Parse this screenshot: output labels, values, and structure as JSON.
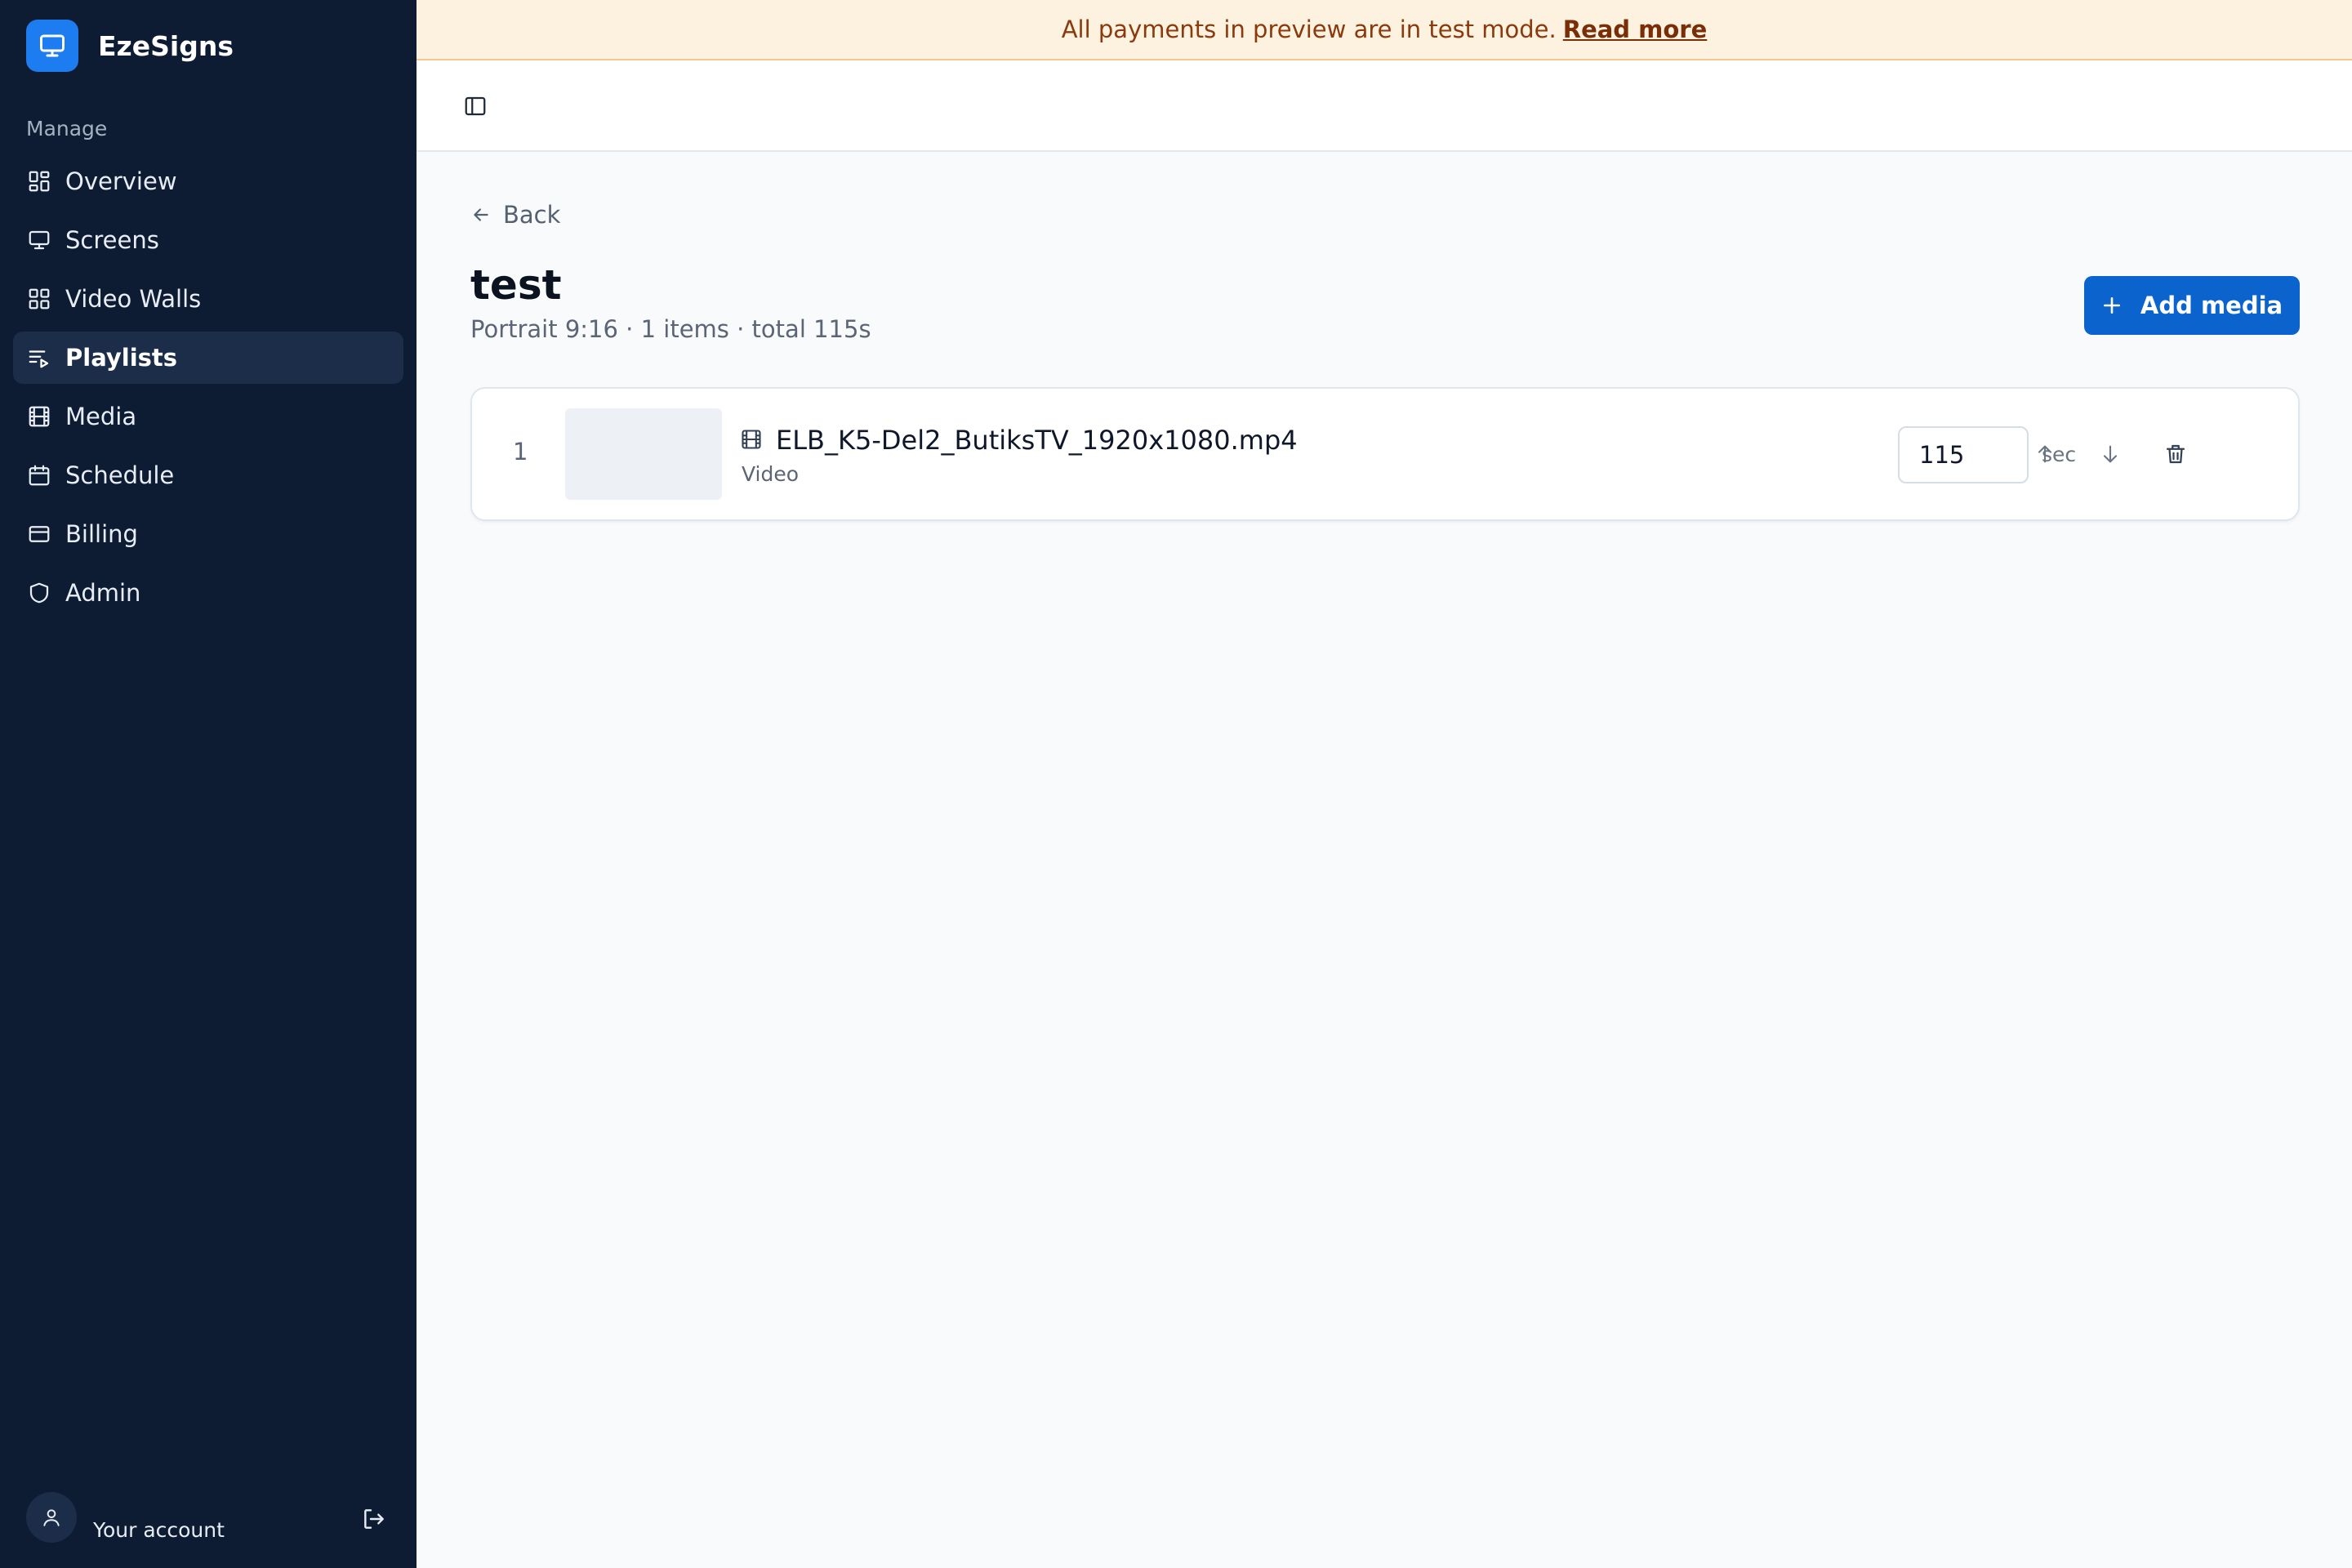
{
  "app": {
    "name": "EzeSigns"
  },
  "sidebar": {
    "section": "Manage",
    "items": [
      {
        "label": "Overview",
        "icon": "dashboard-icon",
        "active": false
      },
      {
        "label": "Screens",
        "icon": "monitor-icon",
        "active": false
      },
      {
        "label": "Video Walls",
        "icon": "grid-icon",
        "active": false
      },
      {
        "label": "Playlists",
        "icon": "playlist-icon",
        "active": true
      },
      {
        "label": "Media",
        "icon": "film-icon",
        "active": false
      },
      {
        "label": "Schedule",
        "icon": "calendar-icon",
        "active": false
      },
      {
        "label": "Billing",
        "icon": "credit-card-icon",
        "active": false
      },
      {
        "label": "Admin",
        "icon": "shield-icon",
        "active": false
      }
    ],
    "account": {
      "label": "Your account"
    }
  },
  "banner": {
    "text": "All payments in preview are in test mode.",
    "link": "Read more"
  },
  "page": {
    "back": "Back",
    "title": "test",
    "subtitle": "Portrait 9:16 · 1 items · total 115s",
    "add_button": "Add media"
  },
  "playlist_items": [
    {
      "index": "1",
      "name": "ELB_K5-Del2_ButiksTV_1920x1080.mp4",
      "type": "Video",
      "duration": "115",
      "unit": "sec"
    }
  ],
  "colors": {
    "sidebar_bg": "#0e1c33",
    "accent": "#0b63ce",
    "banner_bg": "#fdf1df",
    "banner_text": "#8a3a0c"
  }
}
